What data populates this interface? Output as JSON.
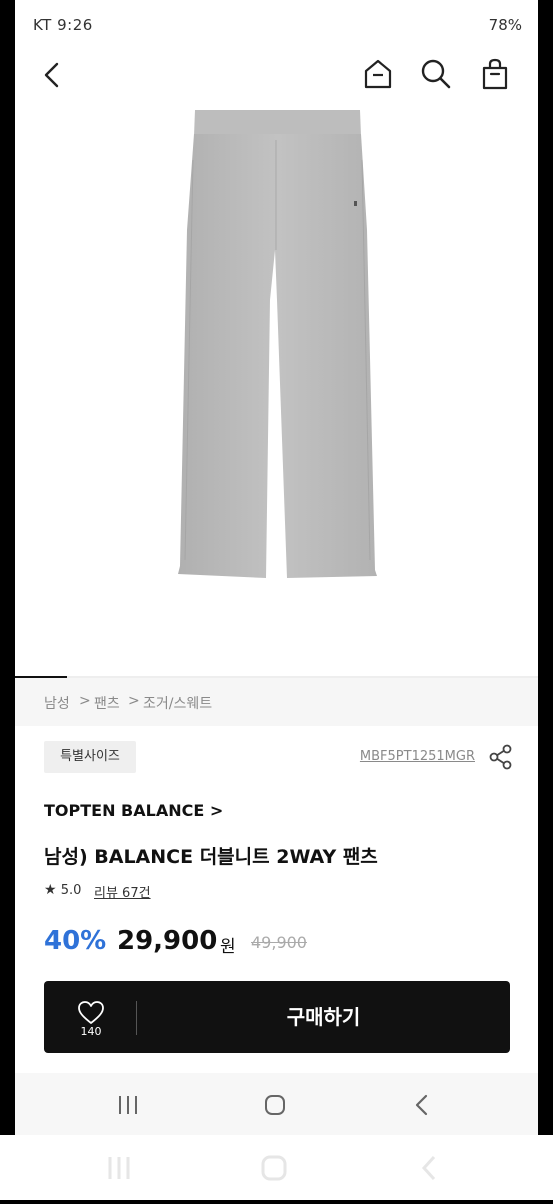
{
  "status": {
    "left": "KT 9:26",
    "right": "78%"
  },
  "breadcrumb": [
    "남성",
    ">",
    "팬츠",
    ">",
    "조거/스웨트"
  ],
  "product": {
    "size_badge": "특별사이즈",
    "code": "MBF5PT1251MGR",
    "brand": "TOPTEN BALANCE >",
    "title": "남성) BALANCE 더블니트 2WAY 팬츠",
    "rating": "5.0",
    "review_link": "리뷰 67건",
    "discount": "40%",
    "price": "29,900",
    "currency": "원",
    "original_price": "49,900"
  },
  "buy": {
    "like_count": "140",
    "label": "구매하기"
  },
  "colors": {
    "accent": "#2f72d8",
    "buy_bg": "#111111",
    "pants": "#b9b9b9"
  }
}
